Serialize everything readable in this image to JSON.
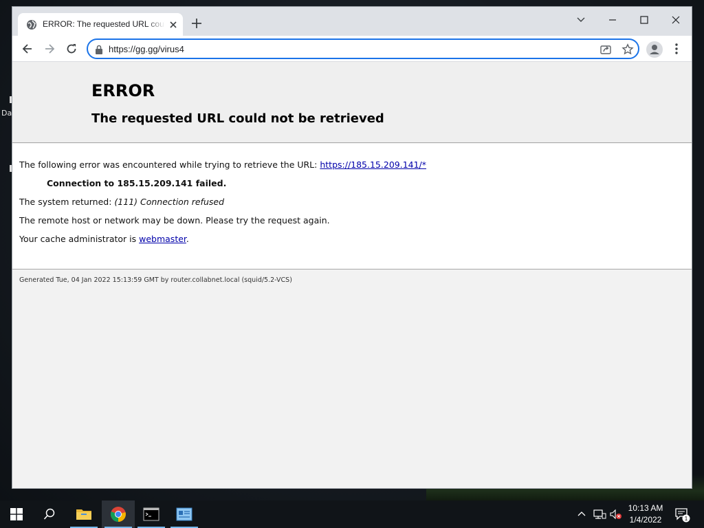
{
  "desktop": {
    "left_label": "Da"
  },
  "browser": {
    "tab_title": "ERROR: The requested URL could not be retrieved",
    "url": "https://gg.gg/virus4"
  },
  "page": {
    "title": "ERROR",
    "subtitle": "The requested URL could not be retrieved",
    "line1_prefix": "The following error was encountered while trying to retrieve the URL: ",
    "line1_link": "https://185.15.209.141/*",
    "line2": "Connection to 185.15.209.141 failed.",
    "line3_prefix": "The system returned: ",
    "line3_italic": "(111) Connection refused",
    "line4": "The remote host or network may be down. Please try the request again.",
    "line5_prefix": "Your cache administrator is ",
    "line5_link": "webmaster",
    "line5_suffix": ".",
    "footer": "Generated Tue, 04 Jan 2022 15:13:59 GMT by router.collabnet.local (squid/5.2-VCS)"
  },
  "taskbar": {
    "time": "10:13 AM",
    "date": "1/4/2022",
    "notification_count": "1",
    "icons": [
      "windows-start-icon",
      "search-icon",
      "file-explorer-icon",
      "chrome-icon",
      "command-prompt-icon",
      "app-window-icon"
    ]
  },
  "colors": {
    "accent": "#1a73e8",
    "link": "#0000aa",
    "taskbar": "#101418"
  }
}
